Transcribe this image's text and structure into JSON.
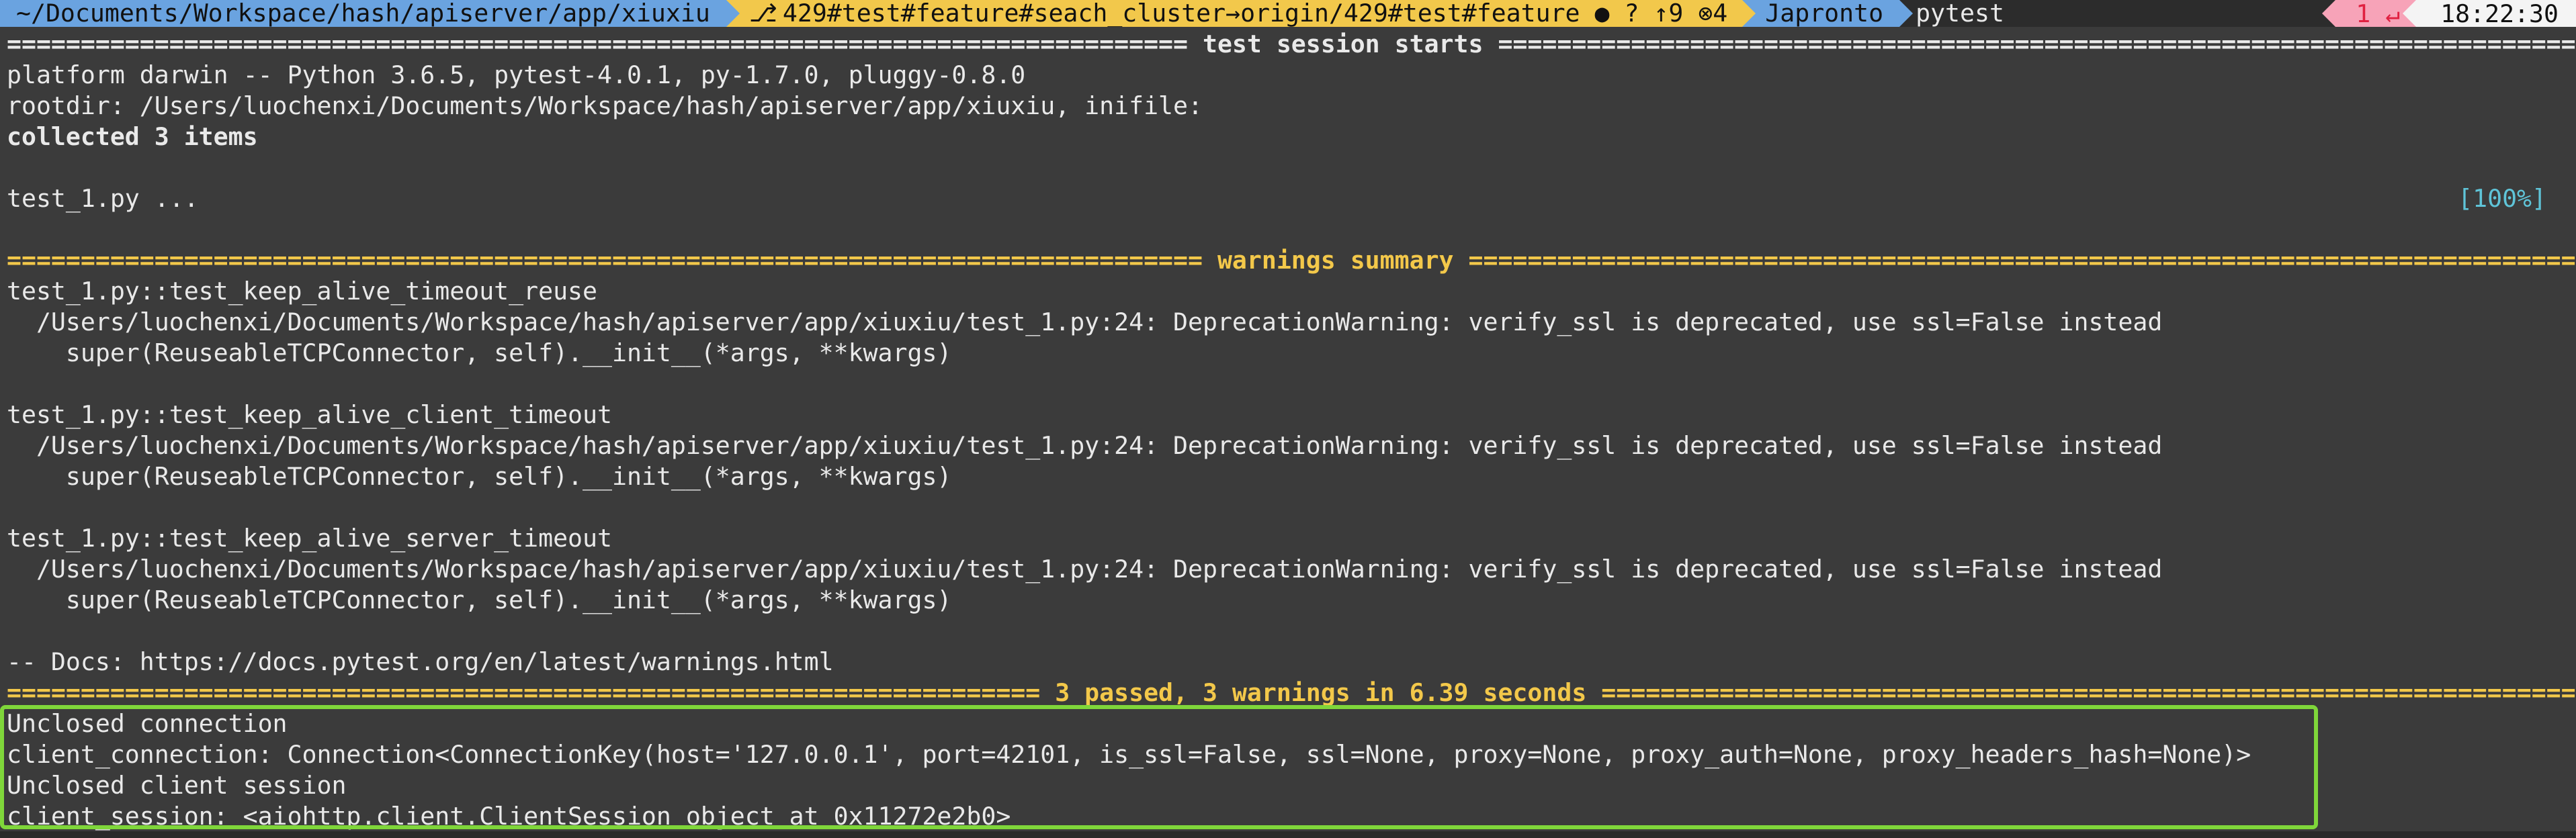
{
  "prompt": {
    "path": "~/Documents/Workspace/hash/apiserver/app/xiuxiu",
    "git_icon": "git-branch-icon",
    "git_branch": "429#test#feature#seach_cluster→origin/429#test#feature ● ? ↑9 ⊗4",
    "venv": "Japronto",
    "command": "pytest",
    "error_code": "1 ↵",
    "time": "18:22:30"
  },
  "terminal": {
    "lines": [
      {
        "text": "================================================================================ test session starts =================================================================================",
        "style": "bold"
      },
      {
        "text": "platform darwin -- Python 3.6.5, pytest-4.0.1, py-1.7.0, pluggy-0.8.0",
        "style": ""
      },
      {
        "text": "rootdir: /Users/luochenxi/Documents/Workspace/hash/apiserver/app/xiuxiu, inifile:",
        "style": ""
      },
      {
        "text": "collected 3 items",
        "style": "bold"
      },
      {
        "text": "",
        "style": ""
      },
      {
        "text": "test_1.py ...",
        "style": "",
        "badge": "[100%]"
      },
      {
        "text": "",
        "style": ""
      },
      {
        "text": "================================================================================= warnings summary =================================================================================",
        "style": "yellow"
      },
      {
        "text": "test_1.py::test_keep_alive_timeout_reuse",
        "style": ""
      },
      {
        "text": "  /Users/luochenxi/Documents/Workspace/hash/apiserver/app/xiuxiu/test_1.py:24: DeprecationWarning: verify_ssl is deprecated, use ssl=False instead",
        "style": ""
      },
      {
        "text": "    super(ReuseableTCPConnector, self).__init__(*args, **kwargs)",
        "style": ""
      },
      {
        "text": "",
        "style": ""
      },
      {
        "text": "test_1.py::test_keep_alive_client_timeout",
        "style": ""
      },
      {
        "text": "  /Users/luochenxi/Documents/Workspace/hash/apiserver/app/xiuxiu/test_1.py:24: DeprecationWarning: verify_ssl is deprecated, use ssl=False instead",
        "style": ""
      },
      {
        "text": "    super(ReuseableTCPConnector, self).__init__(*args, **kwargs)",
        "style": ""
      },
      {
        "text": "",
        "style": ""
      },
      {
        "text": "test_1.py::test_keep_alive_server_timeout",
        "style": ""
      },
      {
        "text": "  /Users/luochenxi/Documents/Workspace/hash/apiserver/app/xiuxiu/test_1.py:24: DeprecationWarning: verify_ssl is deprecated, use ssl=False instead",
        "style": ""
      },
      {
        "text": "    super(ReuseableTCPConnector, self).__init__(*args, **kwargs)",
        "style": ""
      },
      {
        "text": "",
        "style": ""
      },
      {
        "text": "-- Docs: https://docs.pytest.org/en/latest/warnings.html",
        "style": ""
      },
      {
        "text": "====================================================================== 3 passed, 3 warnings in 6.39 seconds ======================================================================",
        "style": "yellow"
      },
      {
        "text": "Unclosed connection",
        "style": ""
      },
      {
        "text": "client_connection: Connection<ConnectionKey(host='127.0.0.1', port=42101, is_ssl=False, ssl=None, proxy=None, proxy_auth=None, proxy_headers_hash=None)>",
        "style": ""
      },
      {
        "text": "Unclosed client session",
        "style": ""
      },
      {
        "text": "client_session: <aiohttp.client.ClientSession object at 0x11272e2b0>",
        "style": ""
      }
    ]
  },
  "colors": {
    "background": "#3b3b3b",
    "prompt_path": "#6aa3e0",
    "prompt_git": "#f2c84b",
    "warning_yellow": "#f3c84a",
    "percent_cyan": "#5fc4d8",
    "highlight_green": "#7fd63a"
  }
}
